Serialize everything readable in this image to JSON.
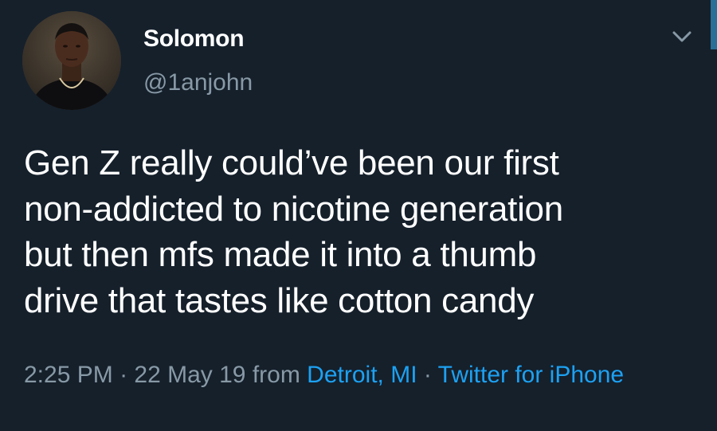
{
  "author": {
    "name": "Solomon",
    "handle": "@1anjohn"
  },
  "tweet": {
    "lines": [
      "Gen Z really could’ve been our first",
      "non-addicted to nicotine generation",
      "but then mfs made it into a thumb",
      "drive that tastes like cotton candy"
    ]
  },
  "meta": {
    "time": "2:25 PM",
    "dot1": " · ",
    "date": "22 May 19",
    "from": " from ",
    "location": "Detroit, MI",
    "dot2": " · ",
    "source": "Twitter for iPhone"
  },
  "icons": {
    "menu": "chevron-down-icon",
    "avatar": "profile-photo"
  },
  "colors": {
    "background": "#15202b",
    "text_primary": "#ffffff",
    "text_secondary": "#8899a6",
    "link": "#1da1f2"
  }
}
